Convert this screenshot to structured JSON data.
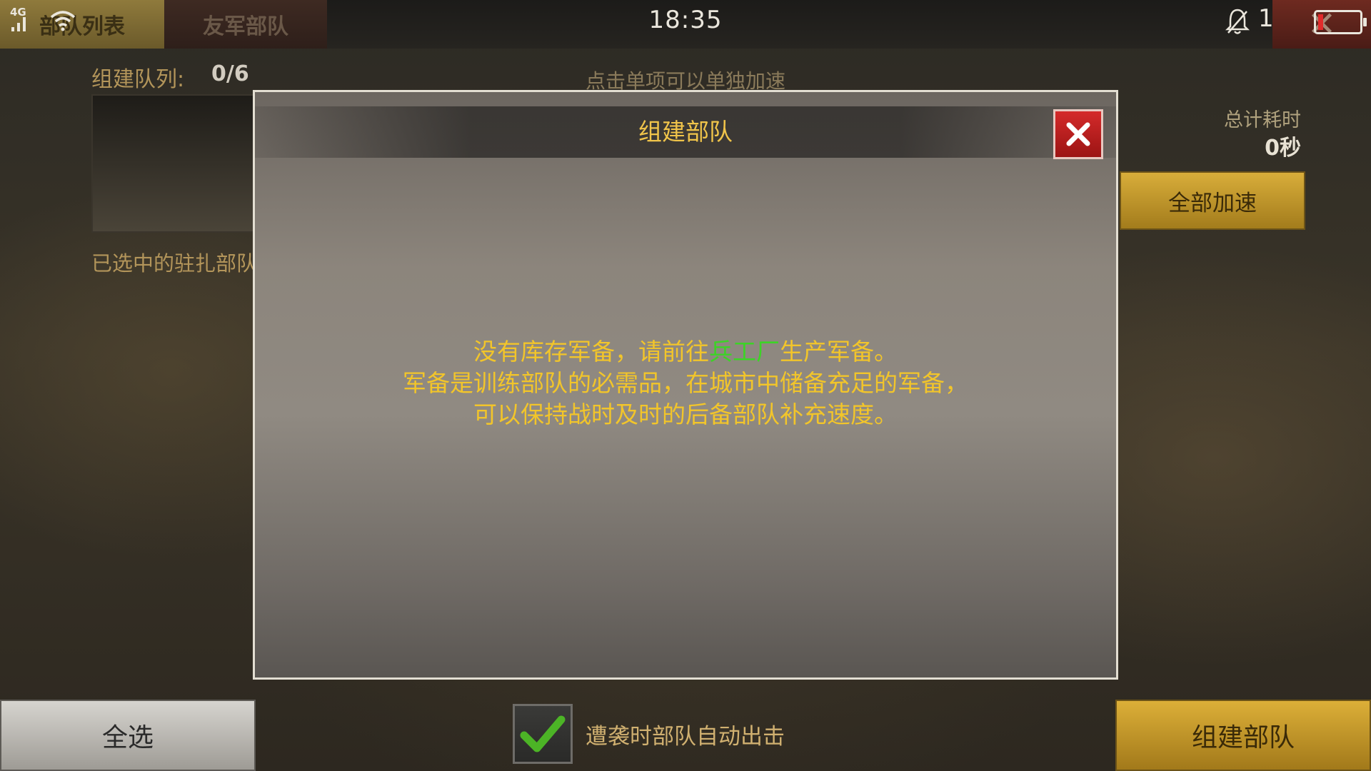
{
  "status_bar": {
    "network": "4G",
    "time": "18:35",
    "battery_percent": "12%",
    "battery_level": 0.12,
    "icons": [
      "signal-icon",
      "wifi-icon",
      "bell-icon",
      "battery-icon"
    ]
  },
  "tabs": [
    {
      "label": "部队列表",
      "active": true
    },
    {
      "label": "友军部队",
      "active": false
    }
  ],
  "screen": {
    "queue_label": "组建队列:",
    "queue_count": "0/6",
    "hint": "点击单项可以单独加速",
    "total_time_label": "总计耗时",
    "total_time_value": "0秒",
    "speedup_all": "全部加速",
    "selected_label": "已选中的驻扎部队"
  },
  "modal": {
    "title": "组建部队",
    "close_icon": "close-icon",
    "message": {
      "line1_before": "没有库存军备，请前往",
      "line1_link": "兵工厂",
      "line1_after": "生产军备。",
      "line2": "军备是训练部队的必需品，在城市中储备充足的军备，",
      "line3": "可以保持战时及时的后备部队补充速度。"
    }
  },
  "bottom_bar": {
    "select_all": "全选",
    "auto_sortie_label": "遭袭时部队自动出击",
    "auto_sortie_checked": true,
    "build": "组建部队"
  },
  "colors": {
    "gold_text": "#f2c52a",
    "link_green": "#3cd426",
    "button_gold": "#dcaf38",
    "close_red": "#c21f1f"
  }
}
